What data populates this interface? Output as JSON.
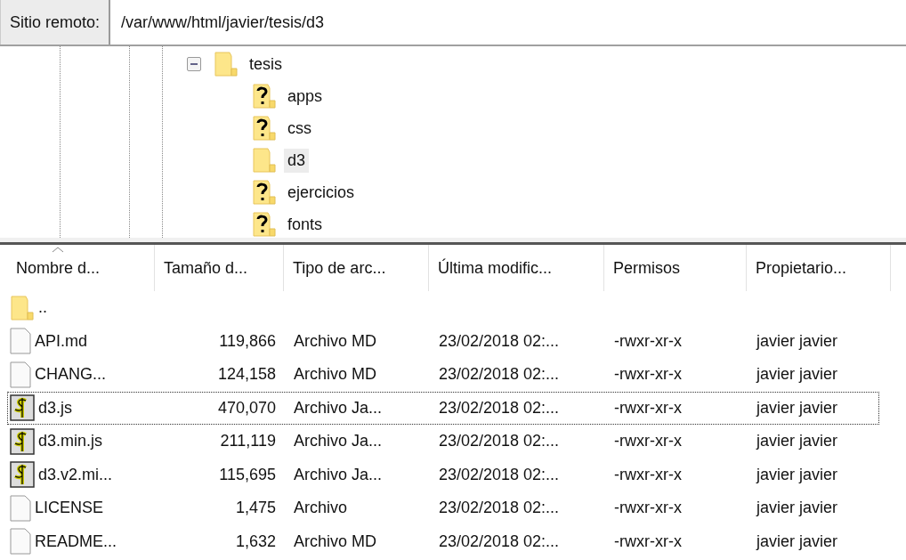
{
  "address_bar": {
    "label": "Sitio remoto:",
    "path": "/var/www/html/javier/tesis/d3"
  },
  "tree": [
    {
      "label": "tesis",
      "kind": "folder",
      "expanded": true,
      "selected": false,
      "children": [
        {
          "label": "apps",
          "kind": "unknown",
          "selected": false
        },
        {
          "label": "css",
          "kind": "unknown",
          "selected": false
        },
        {
          "label": "d3",
          "kind": "folder",
          "selected": true
        },
        {
          "label": "ejercicios",
          "kind": "unknown",
          "selected": false
        },
        {
          "label": "fonts",
          "kind": "unknown",
          "selected": false
        }
      ]
    }
  ],
  "file_list": {
    "columns": [
      {
        "label": "Nombre d...",
        "sorted": true
      },
      {
        "label": "Tamaño d...",
        "sorted": false
      },
      {
        "label": "Tipo de arc...",
        "sorted": false
      },
      {
        "label": "Última modific...",
        "sorted": false
      },
      {
        "label": "Permisos",
        "sorted": false
      },
      {
        "label": "Propietario...",
        "sorted": false
      }
    ],
    "rows": [
      {
        "kind": "folder",
        "cells": [
          ".."
        ],
        "focused": false
      },
      {
        "kind": "file",
        "cells": [
          "API.md",
          "119,866",
          "Archivo MD",
          "23/02/2018 02:...",
          "-rwxr-xr-x",
          "javier javier"
        ],
        "focused": false
      },
      {
        "kind": "file",
        "cells": [
          "CHANG...",
          "124,158",
          "Archivo MD",
          "23/02/2018 02:...",
          "-rwxr-xr-x",
          "javier javier"
        ],
        "focused": false
      },
      {
        "kind": "script",
        "cells": [
          "d3.js",
          "470,070",
          "Archivo Ja...",
          "23/02/2018 02:...",
          "-rwxr-xr-x",
          "javier javier"
        ],
        "focused": true
      },
      {
        "kind": "script",
        "cells": [
          "d3.min.js",
          "211,119",
          "Archivo Ja...",
          "23/02/2018 02:...",
          "-rwxr-xr-x",
          "javier javier"
        ],
        "focused": false
      },
      {
        "kind": "script",
        "cells": [
          "d3.v2.mi...",
          "115,695",
          "Archivo Ja...",
          "23/02/2018 02:...",
          "-rwxr-xr-x",
          "javier javier"
        ],
        "focused": false
      },
      {
        "kind": "file",
        "cells": [
          "LICENSE",
          "1,475",
          "Archivo",
          "23/02/2018 02:...",
          "-rwxr-xr-x",
          "javier javier"
        ],
        "focused": false
      },
      {
        "kind": "file",
        "cells": [
          "README...",
          "1,632",
          "Archivo MD",
          "23/02/2018 02:...",
          "-rwxr-xr-x",
          "javier javier"
        ],
        "focused": false
      }
    ]
  }
}
